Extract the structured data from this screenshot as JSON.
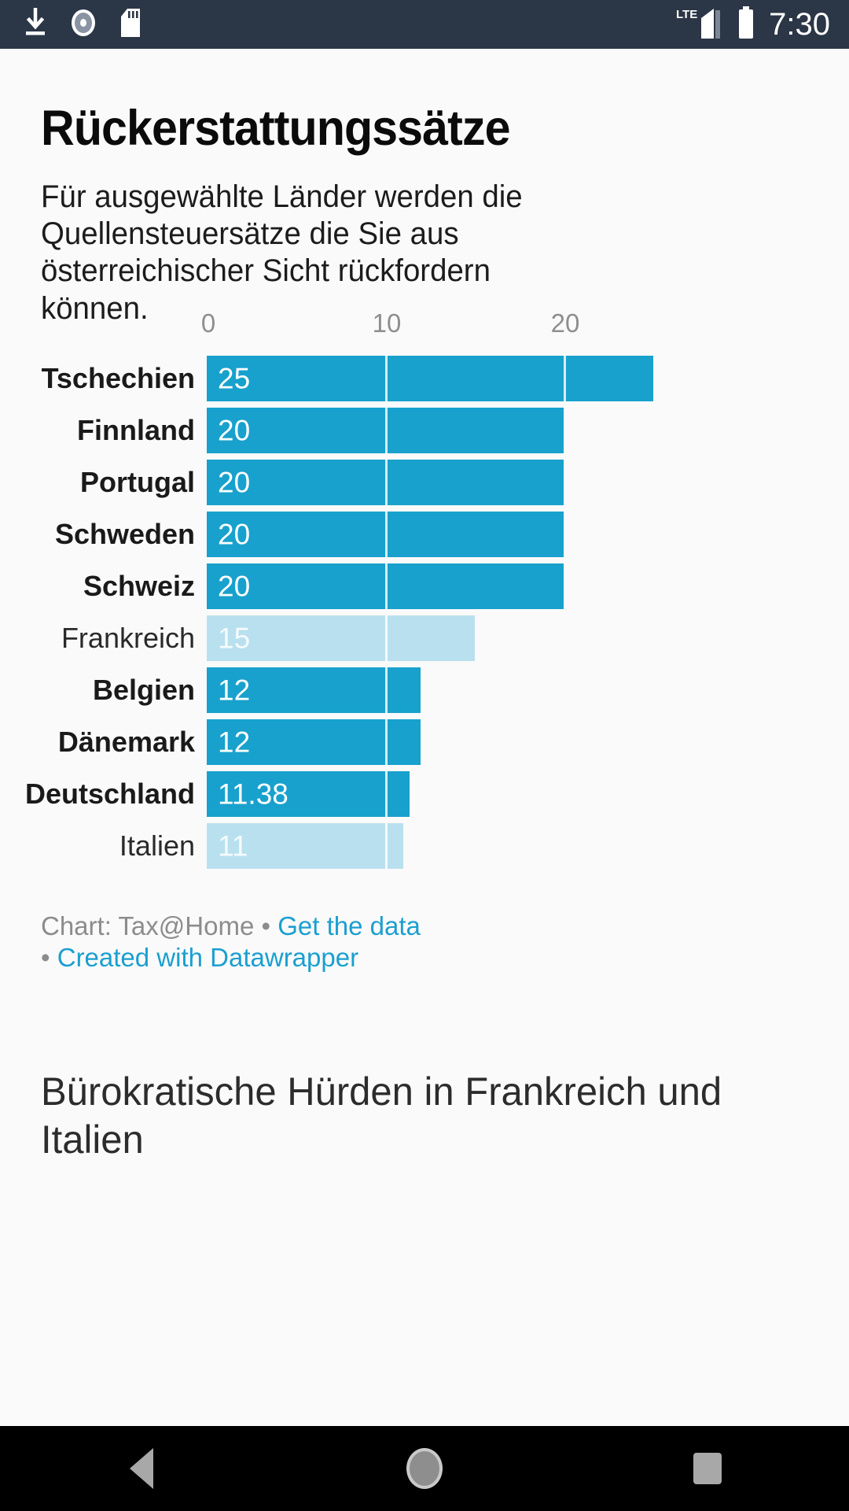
{
  "statusbar": {
    "time": "7:30",
    "network_label": "LTE",
    "icons": [
      "download-icon",
      "disc-icon",
      "sd-card-icon",
      "signal-icon",
      "battery-icon"
    ]
  },
  "article": {
    "headline": "Rückerstattungssätze",
    "subtitle": "Für ausgewählte Länder werden die Quellensteuersätze die Sie aus österreichischer Sicht rückfordern können.",
    "next_section_heading": "Bürokratische Hürden in Frankreich und Italien"
  },
  "credits": {
    "prefix": "Chart: Tax@Home",
    "bullet": "•",
    "get_data_label": "Get the data",
    "created_with_label": "Created with Datawrapper"
  },
  "chart_data": {
    "type": "bar",
    "title": "Rückerstattungssätze",
    "subtitle": "Für ausgewählte Länder werden die Quellensteuersätze die Sie aus österreichischer Sicht rückfordern können.",
    "orientation": "horizontal",
    "xlabel": "",
    "ylabel": "",
    "xlim": [
      0,
      25
    ],
    "ticks": [
      0,
      10,
      20
    ],
    "tick_labels": [
      "0",
      "10",
      "20"
    ],
    "grid": true,
    "legend": "none",
    "colors": {
      "primary": "#18a1cd",
      "highlight_muted": "#b9e0ef"
    },
    "categories": [
      "Tschechien",
      "Finnland",
      "Portugal",
      "Schweden",
      "Schweiz",
      "Frankreich",
      "Belgien",
      "Dänemark",
      "Deutschland",
      "Italien"
    ],
    "values": [
      25,
      20,
      20,
      20,
      20,
      15,
      12,
      12,
      11.38,
      11
    ],
    "value_labels": [
      "25",
      "20",
      "20",
      "20",
      "20",
      "15",
      "12",
      "12",
      "11.38",
      "11"
    ],
    "bars": [
      {
        "label": "Tschechien",
        "value": 25,
        "value_label": "25",
        "muted": false
      },
      {
        "label": "Finnland",
        "value": 20,
        "value_label": "20",
        "muted": false
      },
      {
        "label": "Portugal",
        "value": 20,
        "value_label": "20",
        "muted": false
      },
      {
        "label": "Schweden",
        "value": 20,
        "value_label": "20",
        "muted": false
      },
      {
        "label": "Schweiz",
        "value": 20,
        "value_label": "20",
        "muted": false
      },
      {
        "label": "Frankreich",
        "value": 15,
        "value_label": "15",
        "muted": true
      },
      {
        "label": "Belgien",
        "value": 12,
        "value_label": "12",
        "muted": false
      },
      {
        "label": "Dänemark",
        "value": 12,
        "value_label": "12",
        "muted": false
      },
      {
        "label": "Deutschland",
        "value": 11.38,
        "value_label": "11.38",
        "muted": false
      },
      {
        "label": "Italien",
        "value": 11,
        "value_label": "11",
        "muted": true
      }
    ]
  },
  "navbar": {
    "back_label": "Back",
    "home_label": "Home",
    "recents_label": "Recents"
  }
}
